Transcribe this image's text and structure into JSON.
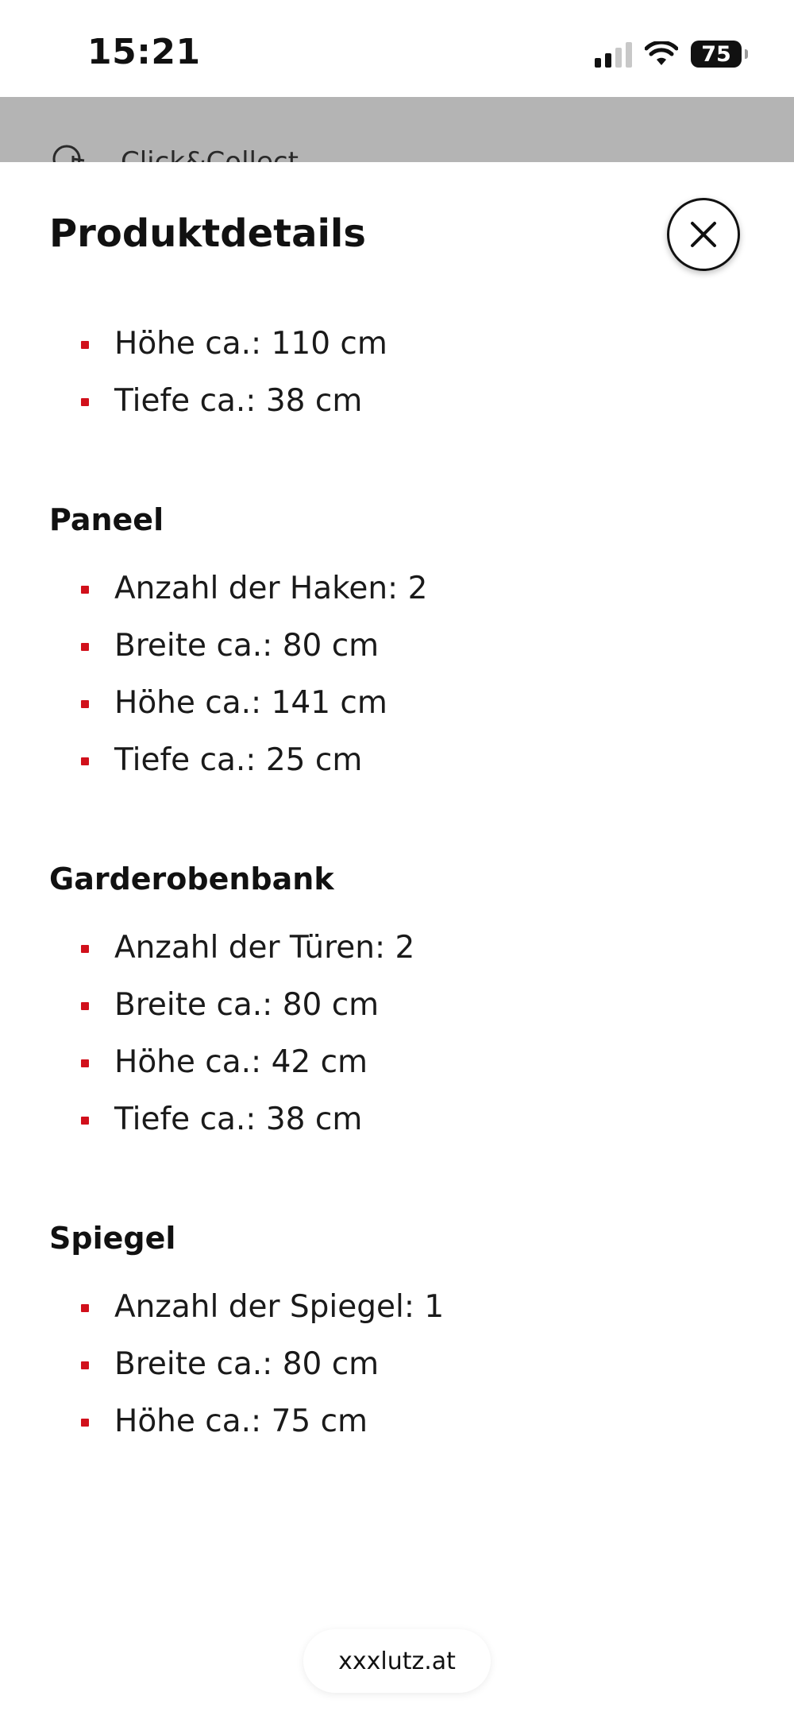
{
  "status_bar": {
    "time": "15:21",
    "battery": "75"
  },
  "background_page": {
    "item_label": "Click&Collect"
  },
  "sheet": {
    "title": "Produktdetails",
    "intro_items": [
      "Höhe ca.: 110 cm",
      "Tiefe ca.: 38 cm"
    ],
    "groups": [
      {
        "title": "Paneel",
        "items": [
          "Anzahl der Haken: 2",
          "Breite ca.: 80 cm",
          "Höhe ca.: 141 cm",
          "Tiefe ca.: 25 cm"
        ]
      },
      {
        "title": "Garderobenbank",
        "items": [
          "Anzahl der Türen: 2",
          "Breite ca.: 80 cm",
          "Höhe ca.: 42 cm",
          "Tiefe ca.: 38 cm"
        ]
      },
      {
        "title": "Spiegel",
        "items": [
          "Anzahl der Spiegel: 1",
          "Breite ca.: 80 cm",
          "Höhe ca.: 75 cm"
        ]
      }
    ]
  },
  "browser": {
    "url": "xxxlutz.at"
  },
  "colors": {
    "bullet": "#d1101b",
    "overlay": "#b4b4b4"
  },
  "icons": {
    "close": "close-x-icon",
    "click_collect": "hand-pointer-icon"
  }
}
